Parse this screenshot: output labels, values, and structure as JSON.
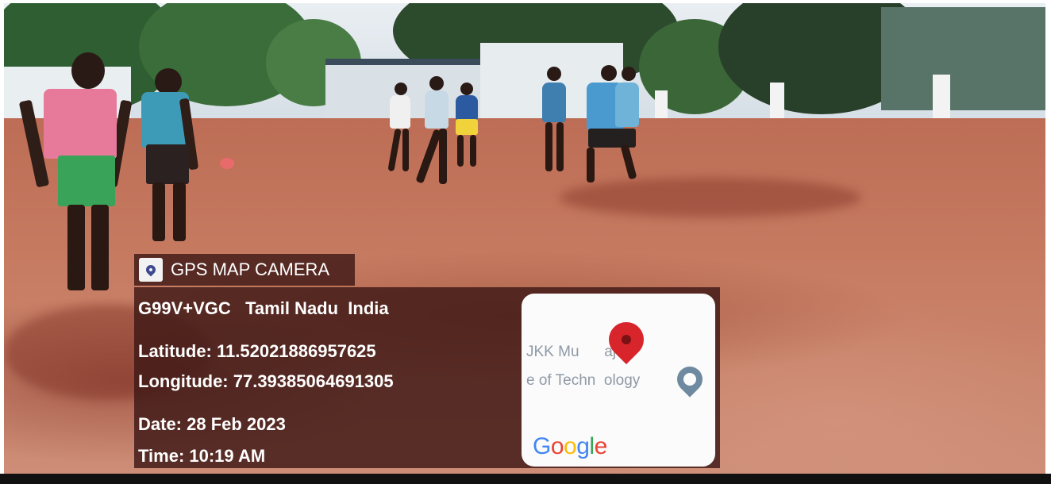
{
  "overlay": {
    "app_name": "GPS MAP CAMERA",
    "address": "G99V+VGC   Tamil Nadu  India",
    "latitude": "Latitude: 11.52021886957625",
    "longitude": "Longitude: 77.39385064691305",
    "date": "Date: 28 Feb 2023",
    "time": "Time: 10:19 AM",
    "map": {
      "poi_text": "JKK Mu      ajah\ne of Techn  ology",
      "provider_logo": "Google",
      "logo_letter_colors": [
        "#4285F4",
        "#EA4335",
        "#FBBC05",
        "#4285F4",
        "#34A853",
        "#EA4335"
      ]
    },
    "icons": {
      "app_logo": "map-pin-shield-icon",
      "map_marker": "red-location-pin-icon",
      "poi_marker": "gray-poi-pin-icon"
    }
  }
}
